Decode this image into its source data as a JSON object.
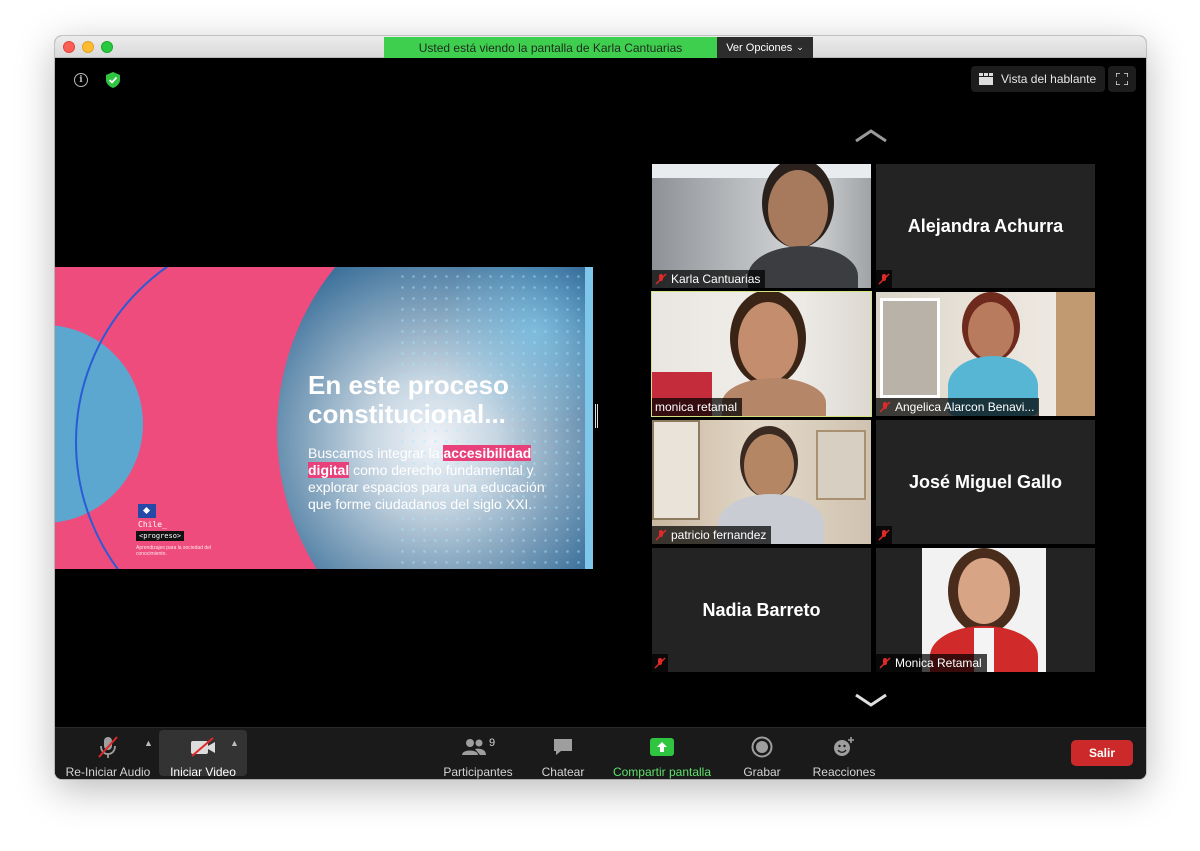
{
  "window": {
    "share_banner": "Usted está viendo la pantalla de Karla Cantuarias",
    "options_button": "Ver Opciones"
  },
  "top_bar": {
    "speaker_view": "Vista del hablante"
  },
  "slide": {
    "title": "En este proceso constitucional...",
    "body_1": "Buscamos integrar la ",
    "highlight_1": "accesibilidad",
    "highlight_2": "digital",
    "body_2": " como derecho fundamental y explorar espacios para una educación que forme ciudadanos del siglo XXI.",
    "logo_line_1": "Chile_",
    "logo_line_2": "<progreso>",
    "logo_tagline": "Aprendizajes para la sociedad del conocimiento."
  },
  "participants": [
    {
      "name": "Karla Cantuarias",
      "video": true,
      "muted": true
    },
    {
      "name": "Alejandra Achurra",
      "video": false,
      "muted": true
    },
    {
      "name": "monica retamal",
      "video": true,
      "muted": false,
      "active": true
    },
    {
      "name": "Angelica Alarcon Benavi...",
      "video": true,
      "muted": true
    },
    {
      "name": "patricio fernandez",
      "video": true,
      "muted": true
    },
    {
      "name": "José Miguel Gallo",
      "video": false,
      "muted": true
    },
    {
      "name": "Nadia Barreto",
      "video": false,
      "muted": true
    },
    {
      "name": "Monica Retamal",
      "video": true,
      "muted": true
    }
  ],
  "toolbar": {
    "audio": "Re-Iniciar Audio",
    "video": "Iniciar Video",
    "participants": "Participantes",
    "participants_count": "9",
    "chat": "Chatear",
    "share": "Compartir pantalla",
    "record": "Grabar",
    "reactions": "Reacciones",
    "leave": "Salir"
  },
  "colors": {
    "share_green": "#3fcf4f",
    "slide_pink": "#ee4c7d",
    "active_speaker": "#d3e27e",
    "leave_red": "#cc2a2a"
  }
}
